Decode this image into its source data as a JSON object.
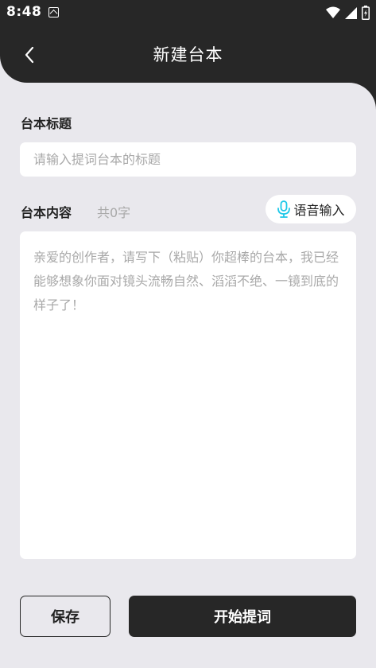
{
  "status_bar": {
    "time": "8:48",
    "icons": [
      "notification-icon",
      "wifi-icon",
      "signal-icon",
      "battery-icon"
    ]
  },
  "nav": {
    "title": "新建台本",
    "back_icon": "chevron-left-icon"
  },
  "title_section": {
    "label": "台本标题",
    "input_value": "",
    "placeholder": "请输入提词台本的标题"
  },
  "content_section": {
    "label": "台本内容",
    "char_count": "共0字",
    "voice_button_label": "语音输入",
    "voice_icon": "microphone-icon",
    "textarea_value": "",
    "placeholder": "亲爱的创作者，请写下（粘贴）你超棒的台本，我已经能够想象你面对镜头流畅自然、滔滔不绝、一镜到底的样子了！"
  },
  "actions": {
    "save_label": "保存",
    "start_label": "开始提词"
  },
  "colors": {
    "header_bg": "#272727",
    "page_bg": "#e9e8ed",
    "card_bg": "#ffffff",
    "placeholder_text": "#a9a9a9",
    "mic_accent": "#1ec8e8"
  }
}
